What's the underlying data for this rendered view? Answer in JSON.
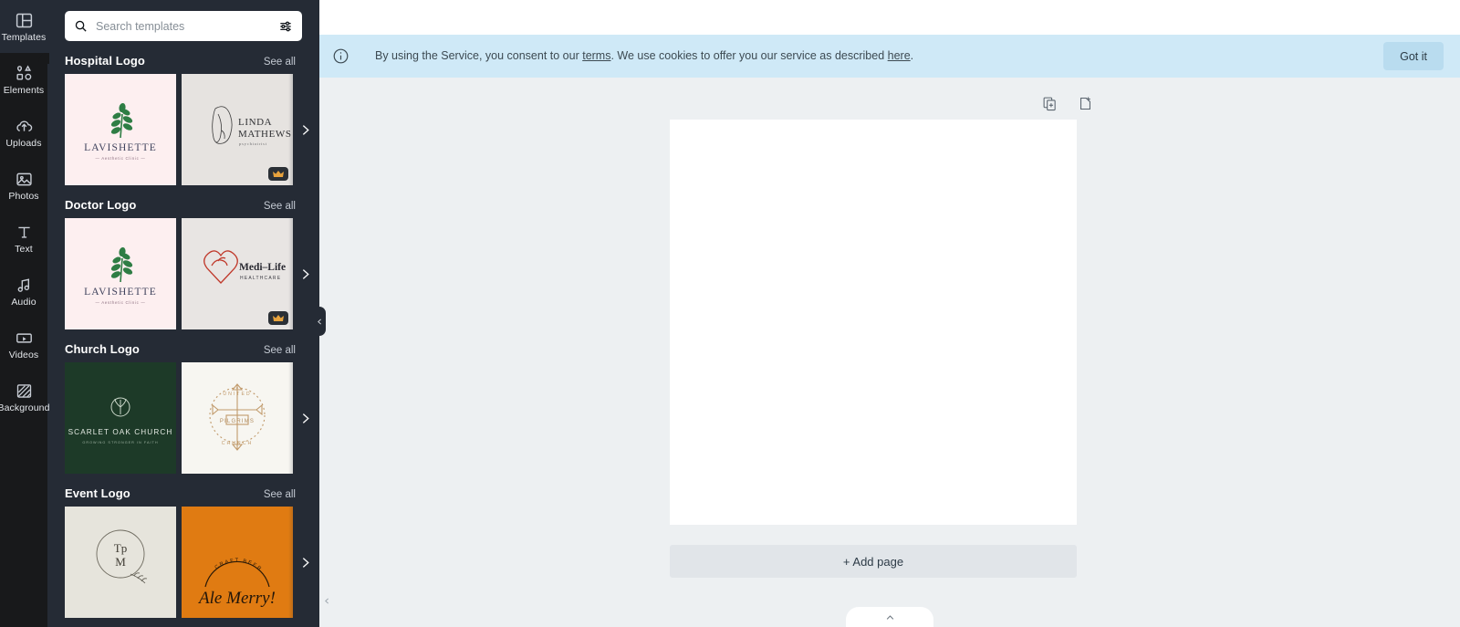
{
  "rail": {
    "items": [
      {
        "label": "Templates",
        "icon": "templates-icon",
        "active": true
      },
      {
        "label": "Elements",
        "icon": "elements-icon",
        "active": false
      },
      {
        "label": "Uploads",
        "icon": "uploads-icon",
        "active": false
      },
      {
        "label": "Photos",
        "icon": "photos-icon",
        "active": false
      },
      {
        "label": "Text",
        "icon": "text-icon",
        "active": false
      },
      {
        "label": "Audio",
        "icon": "audio-icon",
        "active": false
      },
      {
        "label": "Videos",
        "icon": "videos-icon",
        "active": false
      },
      {
        "label": "Background",
        "icon": "background-icon",
        "active": false
      }
    ]
  },
  "search": {
    "placeholder": "Search templates",
    "value": "",
    "search_icon": "search-icon",
    "filter_icon": "filter-sliders-icon"
  },
  "panel": {
    "see_all_label": "See all",
    "collapse_icon": "chevron-left-icon",
    "next_icon": "chevron-right-icon",
    "pro_badge_icon": "crown-icon",
    "sections": [
      {
        "title": "Hospital Logo",
        "cards": [
          {
            "name": "lavishette-aesthetic-clinic",
            "brand": "LAVISHETTE",
            "tagline": "Aesthetic Clinic",
            "pro": false,
            "bg": "#fdeff0"
          },
          {
            "name": "linda-mathews-psychiatrist",
            "brand": "LINDA MATHEWS",
            "tagline": "psychiatrist",
            "pro": true,
            "bg": "#e6e3e0"
          }
        ]
      },
      {
        "title": "Doctor Logo",
        "cards": [
          {
            "name": "lavishette-aesthetic-clinic",
            "brand": "LAVISHETTE",
            "tagline": "Aesthetic Clinic",
            "pro": false,
            "bg": "#fdeff0"
          },
          {
            "name": "medi-life-healthcare",
            "brand": "Medi-Life",
            "tagline": "HEALTHCARE",
            "pro": true,
            "bg": "#e8e5e3"
          }
        ]
      },
      {
        "title": "Church Logo",
        "cards": [
          {
            "name": "scarlet-oak-church",
            "brand": "SCARLET OAK CHURCH",
            "tagline": "GROWING STRONGER IN FAITH",
            "pro": false,
            "bg": "#1d3a28"
          },
          {
            "name": "united-pilgrims-church",
            "brand": "PILGRIMS",
            "tagline": "UNITED CHURCH",
            "pro": false,
            "bg": "#f7f6f1"
          }
        ]
      },
      {
        "title": "Event Logo",
        "cards": [
          {
            "name": "tpm-monogram",
            "brand": "TpM",
            "tagline": "",
            "pro": false,
            "bg": "#e6e4dc"
          },
          {
            "name": "ale-merry-craft-beer",
            "brand": "Ale Merry!",
            "tagline": "CRAFT BEER",
            "pro": false,
            "bg": "#e07b12"
          }
        ]
      }
    ]
  },
  "cookie": {
    "info_icon": "info-icon",
    "text_before": "By using the Service, you consent to our ",
    "link_terms": "terms",
    "text_middle": ". We use cookies to offer you our service as described ",
    "link_here": "here",
    "text_after": ".",
    "got_it_label": "Got it",
    "accent": "#cfe9f7"
  },
  "editor": {
    "duplicate_page_icon": "duplicate-page-icon",
    "add_page_icon": "add-page-icon",
    "add_page_label": "+ Add page",
    "canvas_collapse_icon": "chevron-left-icon",
    "bottom_tab_icon": "chevron-up-icon"
  }
}
